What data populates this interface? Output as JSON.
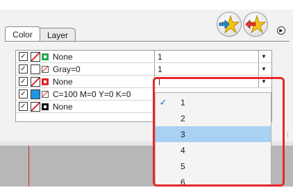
{
  "tabs": [
    "Color",
    "Layer"
  ],
  "rows": [
    {
      "fill": "none",
      "stroke": "green",
      "label": "None",
      "value": "1"
    },
    {
      "fill": "white",
      "stroke": "none",
      "label": "Gray=0",
      "value": "1"
    },
    {
      "fill": "none",
      "stroke": "red",
      "label": "None",
      "value": ""
    },
    {
      "fill": "cyan",
      "stroke": "none",
      "label": "C=100 M=0 Y=0 K=0",
      "value": ""
    },
    {
      "fill": "none",
      "stroke": "black",
      "label": "None",
      "value": ""
    }
  ],
  "dropdown": {
    "selected_index": 2,
    "checked_index": 0,
    "options": [
      "1",
      "2",
      "3",
      "4",
      "5",
      "6"
    ]
  },
  "icons": {
    "star_button_1": "star-arrow-in-icon",
    "star_button_2": "star-arrow-out-icon",
    "panel_menu": "panel-menu-icon"
  },
  "colors": {
    "highlight": "#e8262c",
    "selection": "#a9d1f3",
    "swatch_cyan": "#1e96e0",
    "stroke_green": "#2aa84a",
    "stroke_red": "#e0242a"
  }
}
